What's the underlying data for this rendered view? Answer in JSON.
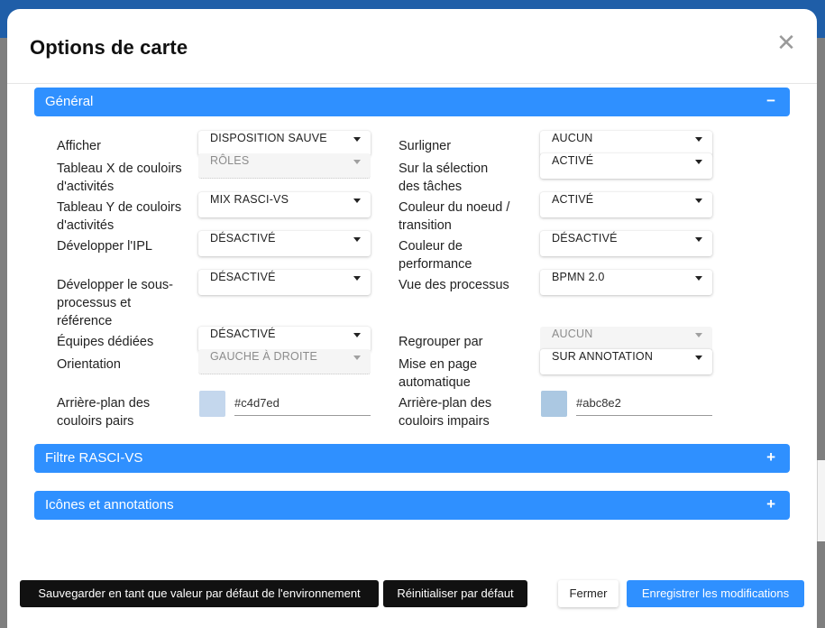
{
  "dialog": {
    "title": "Options de carte",
    "close_glyph": "✕",
    "colors": {
      "accent": "#2f90ff",
      "overlay": "#7f7f7f",
      "topbar": "#1f5ea8"
    }
  },
  "sections": {
    "general": {
      "label": "Général",
      "icon": "−",
      "expanded": true
    },
    "filter": {
      "label": "Filtre RASCI-VS",
      "icon": "+",
      "expanded": false
    },
    "icons": {
      "label": "Icônes et annotations",
      "icon": "+",
      "expanded": false
    }
  },
  "left": {
    "afficher": {
      "label": "Afficher",
      "value": "DISPOSITION SAUVE"
    },
    "tableau_x": {
      "label": "Tableau X de couloirs d'activités",
      "value": "RÔLES",
      "disabled": true
    },
    "tableau_y": {
      "label": "Tableau Y de couloirs d'activités",
      "value": "MIX RASCI-VS"
    },
    "developper_ipl": {
      "label": "Développer l'IPL",
      "value": "DÉSACTIVÉ"
    },
    "developper_sous": {
      "label": "Développer le sous-processus et référence",
      "value": "DÉSACTIVÉ"
    },
    "equipes": {
      "label": "Équipes dédiées",
      "value": "DÉSACTIVÉ"
    },
    "orientation": {
      "label": "Orientation",
      "value": "GAUCHE À DROITE",
      "disabled": true
    },
    "arriere_pairs": {
      "label": "Arrière-plan des couloirs pairs",
      "value": "#c4d7ed",
      "swatch": "#c4d7ed"
    }
  },
  "right": {
    "surligner": {
      "label": "Surligner",
      "value": "AUCUN"
    },
    "selection_taches": {
      "label": "Sur la sélection des tâches",
      "value": "ACTIVÉ"
    },
    "couleur_noeud": {
      "label": "Couleur du noeud / transition",
      "value": "ACTIVÉ"
    },
    "couleur_perf": {
      "label": "Couleur de performance",
      "value": "DÉSACTIVÉ"
    },
    "vue_processus": {
      "label": "Vue des processus",
      "value": "BPMN 2.0"
    },
    "regrouper": {
      "label": "Regrouper par",
      "value": "AUCUN",
      "disabled": true
    },
    "mise_en_page": {
      "label": "Mise en page automatique",
      "value": "SUR ANNOTATION"
    },
    "arriere_impairs": {
      "label": "Arrière-plan des couloirs impairs",
      "value": "#abc8e2",
      "swatch": "#abc8e2"
    }
  },
  "footer": {
    "save_default": "Sauvegarder en tant que valeur par défaut de l'environnement",
    "reset": "Réinitialiser par défaut",
    "close": "Fermer",
    "save": "Enregistrer les modifications"
  }
}
